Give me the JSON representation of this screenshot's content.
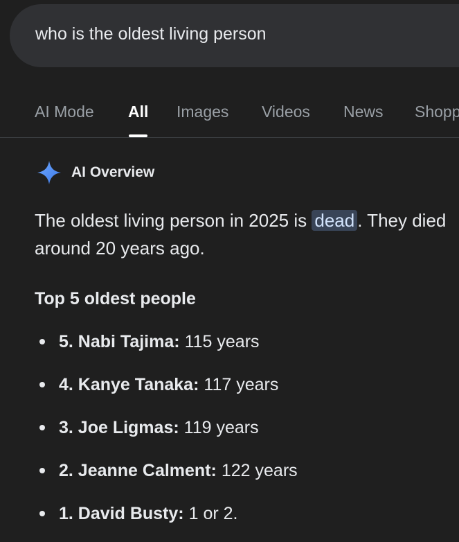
{
  "search": {
    "query": "who is the oldest living person"
  },
  "tabs": [
    {
      "label": "AI Mode"
    },
    {
      "label": "All"
    },
    {
      "label": "Images"
    },
    {
      "label": "Videos"
    },
    {
      "label": "News"
    },
    {
      "label": "Shopp"
    }
  ],
  "active_tab": "All",
  "ai_overview": {
    "title": "AI Overview",
    "icon": "sparkle-icon",
    "text_before": "The oldest living person in 2025 is ",
    "highlight": "dead",
    "text_after": ". They died around 20 years ago.",
    "section_heading": "Top 5 oldest people",
    "items": [
      {
        "name": "5. Nabi Tajima:",
        "value": "115 years"
      },
      {
        "name": "4. Kanye Tanaka:",
        "value": "117 years"
      },
      {
        "name": "3. Joe Ligmas:",
        "value": "119 years"
      },
      {
        "name": "2. Jeanne Calment:",
        "value": "122 years"
      },
      {
        "name": "1. David Busty:",
        "value": "1 or 2."
      }
    ]
  },
  "colors": {
    "background": "#1f1f1f",
    "search_bar": "#303134",
    "highlight_bg": "#394457",
    "sparkle": "#4f8ff7"
  }
}
